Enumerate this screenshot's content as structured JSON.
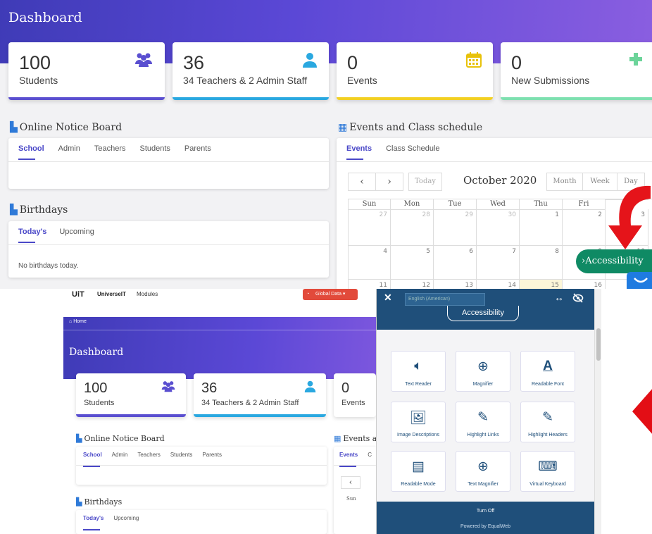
{
  "top": {
    "page_title": "Dashboard",
    "cards": [
      {
        "value": "100",
        "label": "Students",
        "icon": "users-icon",
        "bar_color": "#5a4fd0"
      },
      {
        "value": "36",
        "label": "34 Teachers & 2 Admin Staff",
        "icon": "user-icon",
        "bar_color": "#2aa8e0"
      },
      {
        "value": "0",
        "label": "Events",
        "icon": "calendar-icon",
        "bar_color": "#f2d024"
      },
      {
        "value": "0",
        "label": "New Submissions",
        "icon": "plus-icon",
        "bar_color": "#7ee0b0"
      }
    ],
    "notice_board": {
      "title": "Online Notice Board",
      "tabs": [
        "School",
        "Admin",
        "Teachers",
        "Students",
        "Parents"
      ]
    },
    "birthdays": {
      "title": "Birthdays",
      "tabs": [
        "Today's",
        "Upcoming"
      ],
      "empty_text": "No birthdays today."
    },
    "events": {
      "title": "Events and Class schedule",
      "tabs": [
        "Events",
        "Class Schedule"
      ],
      "calendar": {
        "prev": "‹",
        "next": "›",
        "today": "Today",
        "month_title": "October 2020",
        "views": [
          "Month",
          "Week",
          "Day"
        ],
        "days": [
          "Sun",
          "Mon",
          "Tue",
          "Wed",
          "Thu",
          "Fri",
          ""
        ],
        "rows": [
          [
            "27",
            "28",
            "29",
            "30",
            "1",
            "2",
            "3"
          ],
          [
            "4",
            "5",
            "6",
            "7",
            "8",
            "9",
            "10"
          ],
          [
            "11",
            "12",
            "13",
            "14",
            "15",
            "16",
            ""
          ]
        ]
      }
    },
    "accessibility_button": "Accessibility",
    "accessibility_chevron": "›"
  },
  "bottom": {
    "topbar": {
      "logo": "UiT",
      "brand": "UniverseIT",
      "modules": "Modules",
      "global_data": "Global Data",
      "home": "Home"
    },
    "page_title": "Dashboard",
    "cards": [
      {
        "value": "100",
        "label": "Students"
      },
      {
        "value": "36",
        "label": "34 Teachers & 2 Admin Staff"
      },
      {
        "value": "0",
        "label": "Events"
      }
    ],
    "notice_board": {
      "title": "Online Notice Board",
      "tabs": [
        "School",
        "Admin",
        "Teachers",
        "Students",
        "Parents"
      ]
    },
    "events_title": "Events a",
    "events_tabs": [
      "Events",
      "C"
    ],
    "cal_day": "Sun",
    "birthdays": {
      "title": "Birthdays",
      "tabs": [
        "Today's",
        "Upcoming"
      ]
    },
    "accessibility_panel": {
      "close": "✕",
      "language_placeholder": "English (American)",
      "title": "Accessibility",
      "items": [
        {
          "label": "Text Reader",
          "icon": "speaker-icon"
        },
        {
          "label": "Magnifier",
          "icon": "magnifier-icon"
        },
        {
          "label": "Readable Font",
          "icon": "font-icon"
        },
        {
          "label": "Image Descriptions",
          "icon": "image-icon"
        },
        {
          "label": "Highlight Links",
          "icon": "link-icon"
        },
        {
          "label": "Highlight Headers",
          "icon": "header-icon"
        },
        {
          "label": "Readable Mode",
          "icon": "document-icon"
        },
        {
          "label": "Text Magnifier",
          "icon": "text-magnifier-icon"
        },
        {
          "label": "Virtual Keyboard",
          "icon": "keyboard-icon"
        }
      ],
      "turn_off": "Turn Off",
      "powered_by": "Powered by EqualWeb"
    }
  }
}
